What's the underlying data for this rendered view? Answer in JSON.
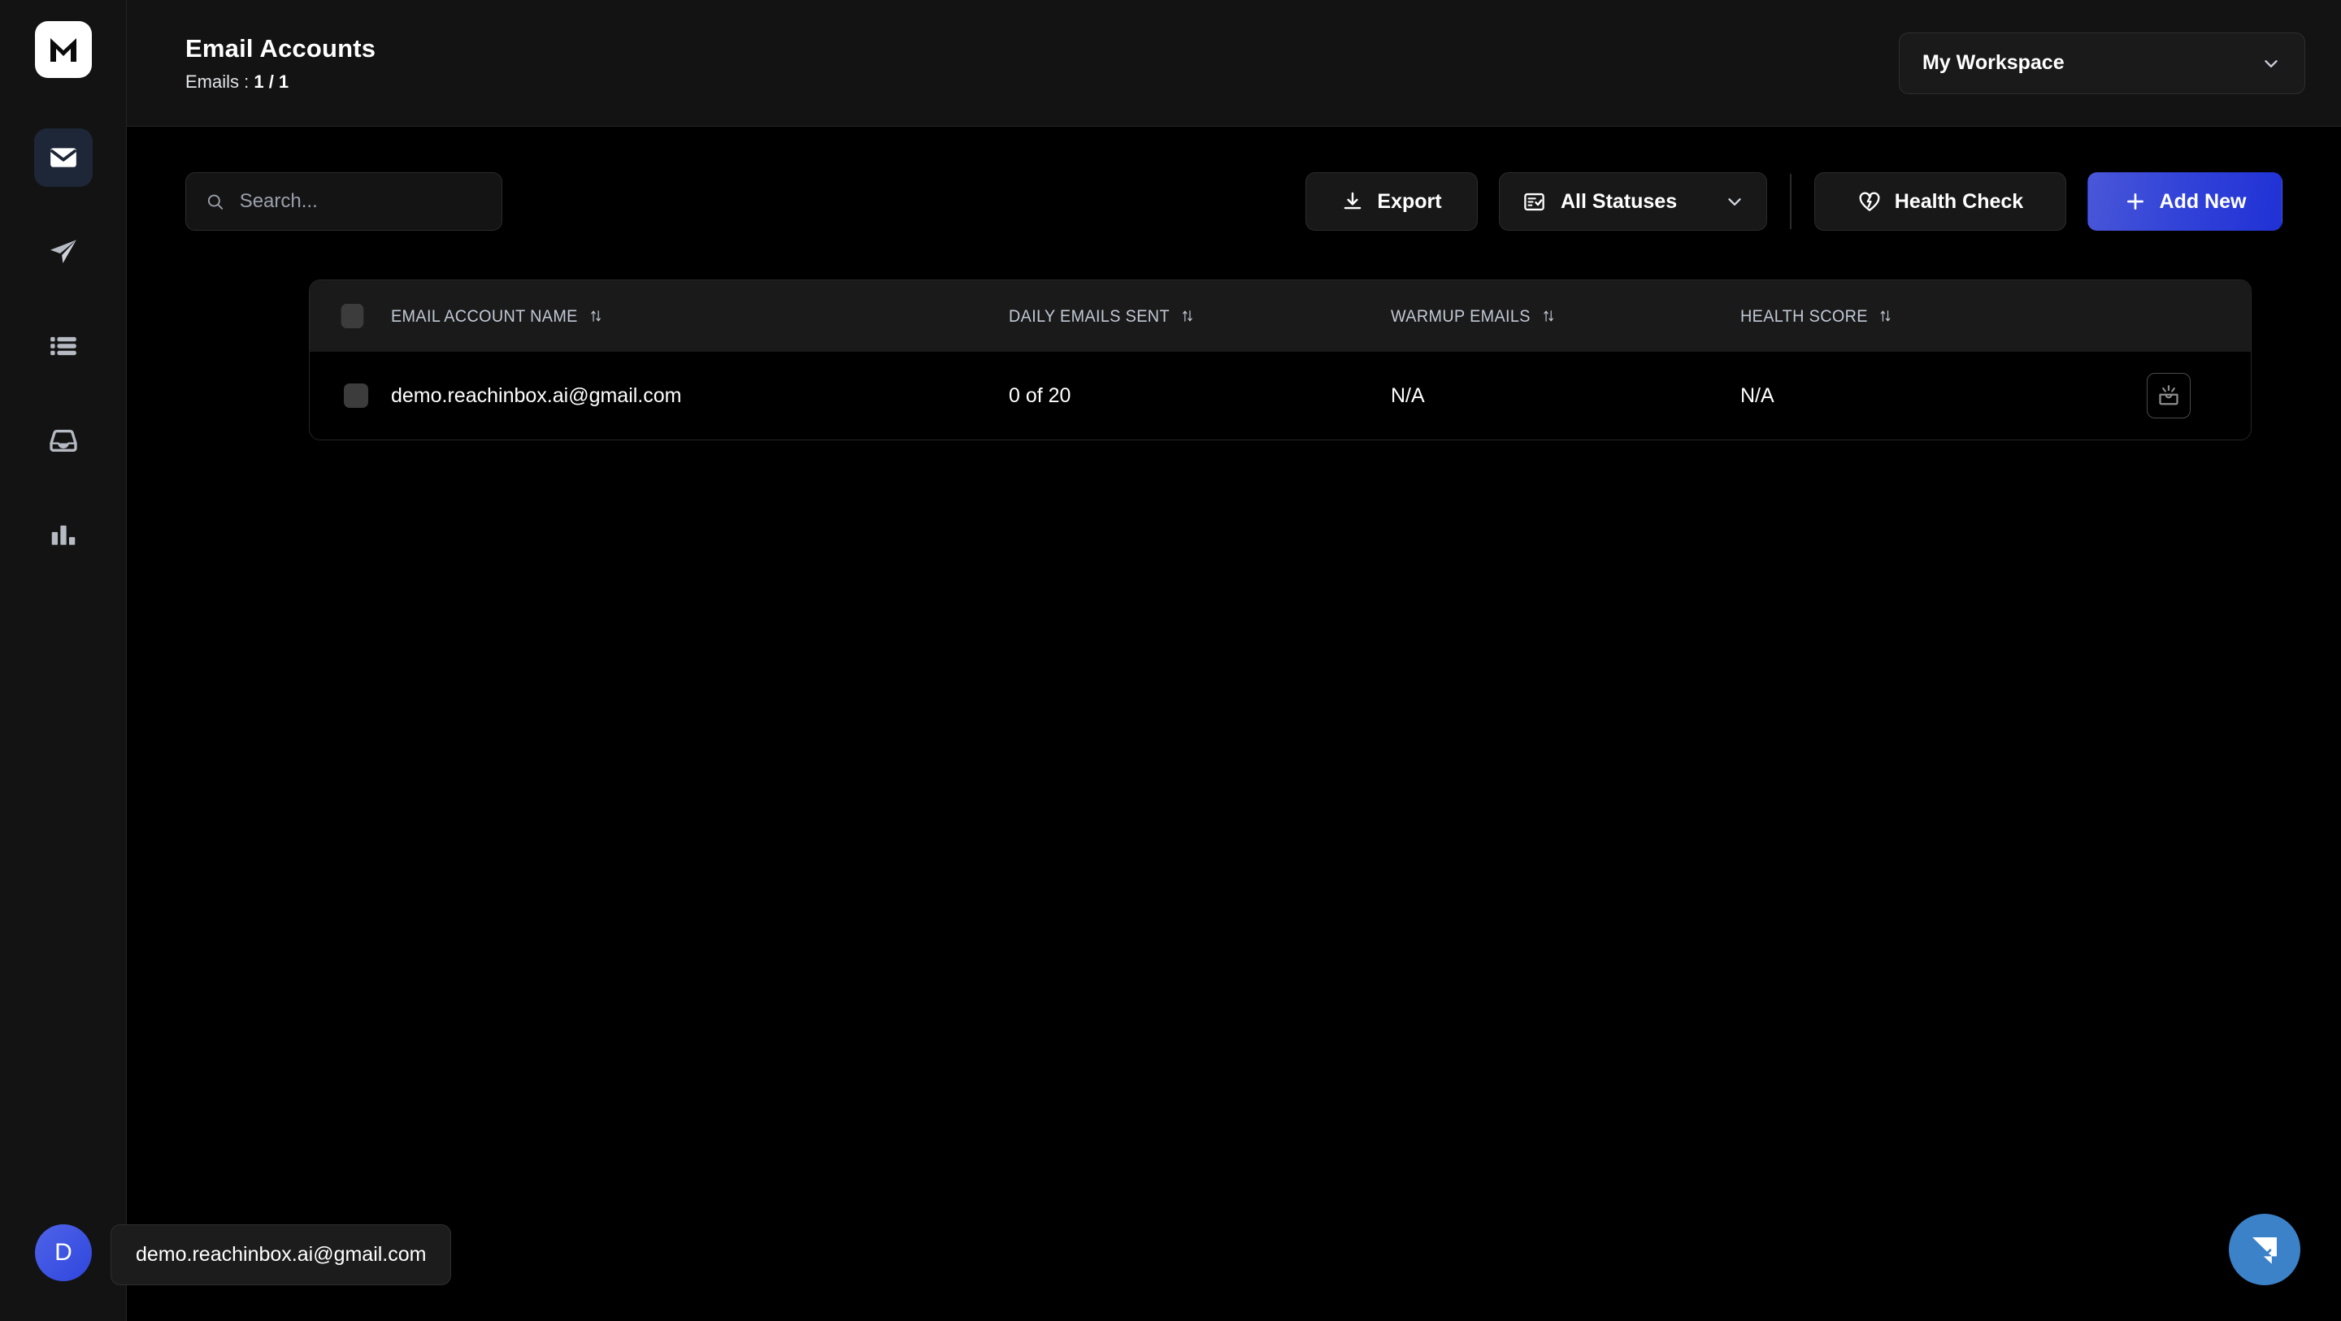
{
  "brand": {
    "logo_letter": "M",
    "accent": "#2f46dd",
    "active_nav_bg": "#1e2738"
  },
  "sidebar": {
    "items": [
      {
        "icon": "mail-icon",
        "name": "email-accounts",
        "active": true
      },
      {
        "icon": "paper-plane-icon",
        "name": "campaigns",
        "active": false
      },
      {
        "icon": "list-icon",
        "name": "lists",
        "active": false
      },
      {
        "icon": "inbox-icon",
        "name": "inbox",
        "active": false
      },
      {
        "icon": "bar-chart-icon",
        "name": "analytics",
        "active": false
      }
    ],
    "avatar_initial": "D"
  },
  "header": {
    "title": "Email Accounts",
    "subtitle_label": "Emails : ",
    "subtitle_value": "1 / 1",
    "workspace": {
      "label": "My Workspace",
      "chevron": "chevron-down-icon"
    }
  },
  "toolbar": {
    "search": {
      "value": "",
      "placeholder": "Search...",
      "icon": "search-icon"
    },
    "export_label": "Export",
    "export_icon": "download-icon",
    "status_label": "All Statuses",
    "status_icon": "list-check-icon",
    "health_label": "Health Check",
    "health_icon": "heart-pulse-icon",
    "add_label": "Add New",
    "add_icon": "plus-icon"
  },
  "table": {
    "columns": [
      {
        "label": "EMAIL ACCOUNT NAME",
        "sort_icon": "sort-arrows-icon"
      },
      {
        "label": "DAILY EMAILS SENT",
        "sort_icon": "sort-arrows-icon"
      },
      {
        "label": "WARMUP EMAILS",
        "sort_icon": "sort-arrows-icon"
      },
      {
        "label": "HEALTH SCORE",
        "sort_icon": "sort-arrows-icon"
      }
    ],
    "rows": [
      {
        "selected": false,
        "name": "demo.reachinbox.ai@gmail.com",
        "daily_emails_sent": "0 of 20",
        "warmup_emails": "N/A",
        "health_score": "N/A",
        "row_icon": "inbox-warmup-icon",
        "menu_icon": "more-horizontal-icon"
      }
    ]
  },
  "tooltip": {
    "text": "demo.reachinbox.ai@gmail.com"
  },
  "chat_widget": {
    "icon": "intercom-chat-icon",
    "color": "#3c82c9"
  }
}
